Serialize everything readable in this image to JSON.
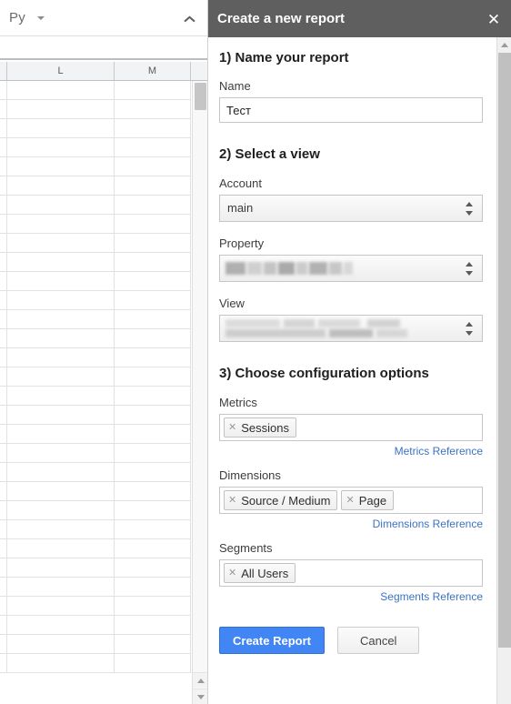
{
  "spreadsheet": {
    "toolbar": {
      "label": "Py",
      "caret_icon": "chevron-down-icon",
      "collapse_icon": "chevron-up-icon"
    },
    "columns": [
      "",
      "L",
      "M",
      ""
    ],
    "row_count": 31,
    "scrollbar": {
      "up_icon": "triangle-up-icon",
      "down_icon": "triangle-down-icon"
    }
  },
  "dialog": {
    "title": "Create a new report",
    "close_icon": "close-icon",
    "accent_color": "#4285f4",
    "header_color": "#5f5f5f",
    "link_color": "#3b73c4",
    "sections": {
      "name": {
        "heading": "1) Name your report",
        "label": "Name",
        "value": "Тест",
        "placeholder": ""
      },
      "view": {
        "heading": "2) Select a view",
        "account": {
          "label": "Account",
          "value": "main"
        },
        "property": {
          "label": "Property",
          "value": "",
          "redacted": true
        },
        "view": {
          "label": "View",
          "value": "",
          "redacted": true
        }
      },
      "config": {
        "heading": "3) Choose configuration options",
        "metrics": {
          "label": "Metrics",
          "chips": [
            "Sessions"
          ],
          "reference_link": "Metrics Reference"
        },
        "dimensions": {
          "label": "Dimensions",
          "chips": [
            "Source / Medium",
            "Page"
          ],
          "reference_link": "Dimensions Reference"
        },
        "segments": {
          "label": "Segments",
          "chips": [
            "All Users"
          ],
          "reference_link": "Segments Reference"
        }
      }
    },
    "actions": {
      "primary": "Create Report",
      "secondary": "Cancel"
    },
    "scrollbar": {
      "up_icon": "triangle-up-icon"
    }
  }
}
